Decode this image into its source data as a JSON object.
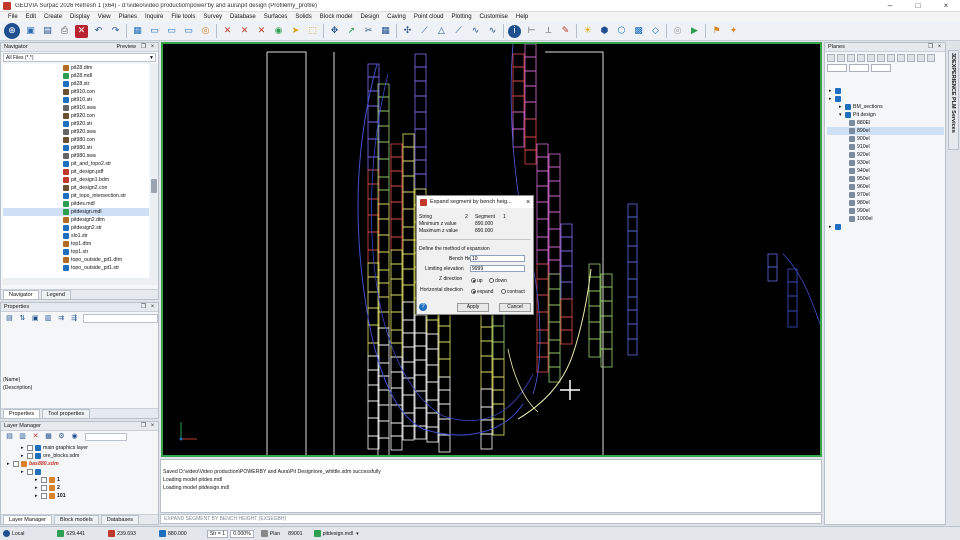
{
  "window": {
    "title": "GEOVIA Surpac 2026 Refresh 1 (x64) - d:\\video\\video production\\power'by and aura\\pit design (Profilemy_profile)"
  },
  "menu": [
    "File",
    "Edit",
    "Create",
    "Display",
    "View",
    "Planes",
    "Inquire",
    "File tools",
    "Survey",
    "Database",
    "Surfaces",
    "Solids",
    "Block model",
    "Design",
    "Caving",
    "Point cloud",
    "Plotting",
    "Customise",
    "Help"
  ],
  "navigator": {
    "title": "Navigator",
    "preview_label": "Preview",
    "filter": "All Files (*.*)",
    "files": [
      {
        "name": "pit28.dtm",
        "icon": "dtm"
      },
      {
        "name": "pit28.mdl",
        "icon": "mdl"
      },
      {
        "name": "pit28.str",
        "icon": "str"
      },
      {
        "name": "pit910.con",
        "icon": "con"
      },
      {
        "name": "pit910.str",
        "icon": "str"
      },
      {
        "name": "pit910.swa",
        "icon": "swa"
      },
      {
        "name": "pit920.con",
        "icon": "con"
      },
      {
        "name": "pit920.str",
        "icon": "str"
      },
      {
        "name": "pit920.swa",
        "icon": "swa"
      },
      {
        "name": "pit980.con",
        "icon": "con"
      },
      {
        "name": "pit980.str",
        "icon": "str"
      },
      {
        "name": "pit980.swa",
        "icon": "swa"
      },
      {
        "name": "pit_and_topo2.str",
        "icon": "str"
      },
      {
        "name": "pit_design.pdf",
        "icon": "pdf"
      },
      {
        "name": "pit_design1.bdm",
        "icon": "bdm"
      },
      {
        "name": "pit_design2.con",
        "icon": "con"
      },
      {
        "name": "pit_topo_intersection.str",
        "icon": "str"
      },
      {
        "name": "pitdes.mdl",
        "icon": "mdl"
      },
      {
        "name": "pitdesign.mdl",
        "icon": "mdl",
        "selected": true
      },
      {
        "name": "pitdesign2.dtm",
        "icon": "dtm"
      },
      {
        "name": "pitdesign2.str",
        "icon": "str"
      },
      {
        "name": "slo1.str",
        "icon": "str"
      },
      {
        "name": "top1.dtm",
        "icon": "dtm"
      },
      {
        "name": "top1.str",
        "icon": "str"
      },
      {
        "name": "topo_outside_pit1.dtm",
        "icon": "dtm"
      },
      {
        "name": "topo_outside_pit1.str",
        "icon": "str"
      }
    ],
    "tabs": [
      "Navigator",
      "Legend"
    ]
  },
  "properties": {
    "title": "Properties",
    "name_label": "(Name)",
    "description_label": "(Description)",
    "tabs": [
      "Properties",
      "Tool properties"
    ]
  },
  "layers": {
    "title": "Layer Manager",
    "items": [
      {
        "label": "main graphics layer",
        "depth": 1,
        "bold": false
      },
      {
        "label": "ore_blocks.sdm",
        "depth": 1,
        "bold": false
      },
      {
        "label": "bas880.sdm",
        "depth": 0,
        "bold": true
      },
      {
        "label": "",
        "depth": 1,
        "bold": false
      },
      {
        "label": "1",
        "depth": 2,
        "bold": true
      },
      {
        "label": "2",
        "depth": 2,
        "bold": true
      },
      {
        "label": "101",
        "depth": 2,
        "bold": true
      }
    ],
    "tabs": [
      "Layer Manager",
      "Block models",
      "Databases"
    ]
  },
  "planes": {
    "title": "Planes",
    "tree": [
      {
        "label": "",
        "depth": 0
      },
      {
        "label": "",
        "depth": 0
      },
      {
        "label": "BM_sections",
        "depth": 1
      },
      {
        "label": "Pit design",
        "depth": 1
      },
      {
        "label": "880El",
        "depth": 2
      },
      {
        "label": "890el",
        "depth": 2,
        "selected": true
      },
      {
        "label": "900el",
        "depth": 2
      },
      {
        "label": "910el",
        "depth": 2
      },
      {
        "label": "920el",
        "depth": 2
      },
      {
        "label": "930el",
        "depth": 2
      },
      {
        "label": "940el",
        "depth": 2
      },
      {
        "label": "950el",
        "depth": 2
      },
      {
        "label": "960el",
        "depth": 2
      },
      {
        "label": "970el",
        "depth": 2
      },
      {
        "label": "980el",
        "depth": 2
      },
      {
        "label": "990el",
        "depth": 2
      },
      {
        "label": "1000el",
        "depth": 2
      },
      {
        "label": "",
        "depth": 0
      }
    ],
    "side_tab": "3DEXPERIENCE PLM Services"
  },
  "dialog": {
    "title": "Expand segment by bench heig...",
    "string_label": "String",
    "string_value": "2",
    "segment_label": "Segment",
    "segment_value": "1",
    "min_z_label": "Minimum z value",
    "min_z_value": "890.000",
    "max_z_label": "Maximum z value",
    "max_z_value": "890.000",
    "method_label": "Define the method of expansion",
    "bench_height_label": "Bench Height",
    "bench_height_value": "10",
    "limiting_label": "Limiting elevation",
    "limiting_value": "9999",
    "z_dir_label": "Z direction",
    "z_up": "up",
    "z_down": "down",
    "h_dir_label": "Horizontal direction",
    "h_expand": "expand",
    "h_contract": "contract",
    "apply": "Apply",
    "cancel": "Cancel"
  },
  "messages": [
    "Saved D:\\video\\Video production\\POWERBY and Aura\\Pit Design\\ore_whittle.sdm successfully",
    "Loading model pitdes.mdl",
    "Loading model pitdesign.mdl"
  ],
  "command": "EXPAND SEGMENT BY BENCH HEIGHT (EXSEGBH)",
  "status": {
    "mode": "Local",
    "y": "629.441",
    "x": "239.693",
    "z": "880.000",
    "str": "Str = 1",
    "zoom": "0.000%",
    "plane": "Plan",
    "code": "89001",
    "model": "pitdesign.mdl"
  },
  "colors": {
    "viewport_border": "#37a64b",
    "accent": "#1f6fbf"
  }
}
